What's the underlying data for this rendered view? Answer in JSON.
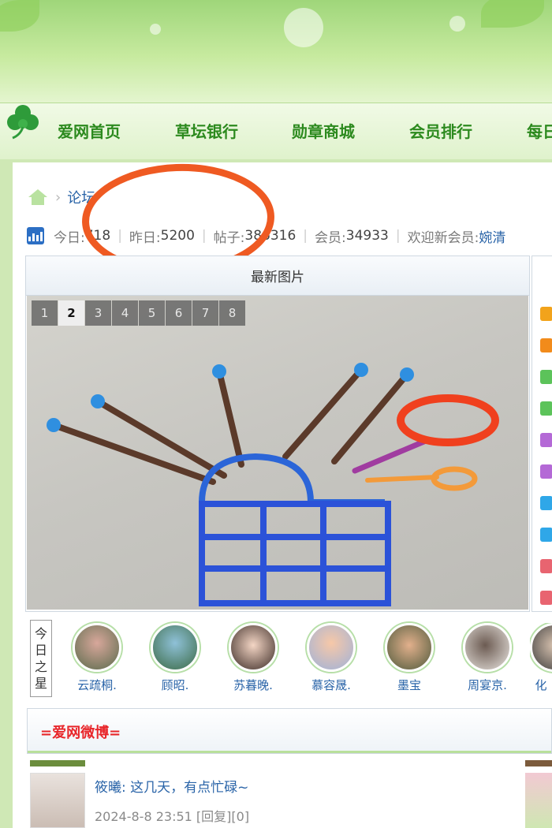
{
  "nav": {
    "items": [
      "爱网首页",
      "草坛银行",
      "勋章商城",
      "会员排行",
      "每日"
    ]
  },
  "breadcrumb": {
    "text": "论坛"
  },
  "stats": {
    "today_label": "今日:",
    "today_value": "718",
    "yesterday_label": "昨日:",
    "yesterday_value": "5200",
    "posts_label": "帖子:",
    "posts_value": "386316",
    "members_label": "会员:",
    "members_value": "34933",
    "newmember_label": "欢迎新会员:",
    "newmember_value": "婉清"
  },
  "latest_images": {
    "title": "最新图片",
    "pages": [
      "1",
      "2",
      "3",
      "4",
      "5",
      "6",
      "7",
      "8"
    ],
    "active_page": "2"
  },
  "today_star": {
    "label": [
      "今",
      "日",
      "之",
      "星"
    ],
    "members": [
      "云疏桐.",
      "顾昭.",
      "苏暮晚.",
      "慕容晟.",
      "墨宝",
      "周宴京.",
      "化"
    ]
  },
  "weibo": {
    "title": "=爱网微博=",
    "post": {
      "text": "筱曦: 这几天，有点忙碌~",
      "meta": "2024-8-8 23:51 [回复][0]"
    }
  },
  "colors": {
    "nav_text": "#2c8a1e",
    "link": "#2a64a8",
    "weibo_title": "#e8262a",
    "annotation_circle": "#ef5a22"
  }
}
